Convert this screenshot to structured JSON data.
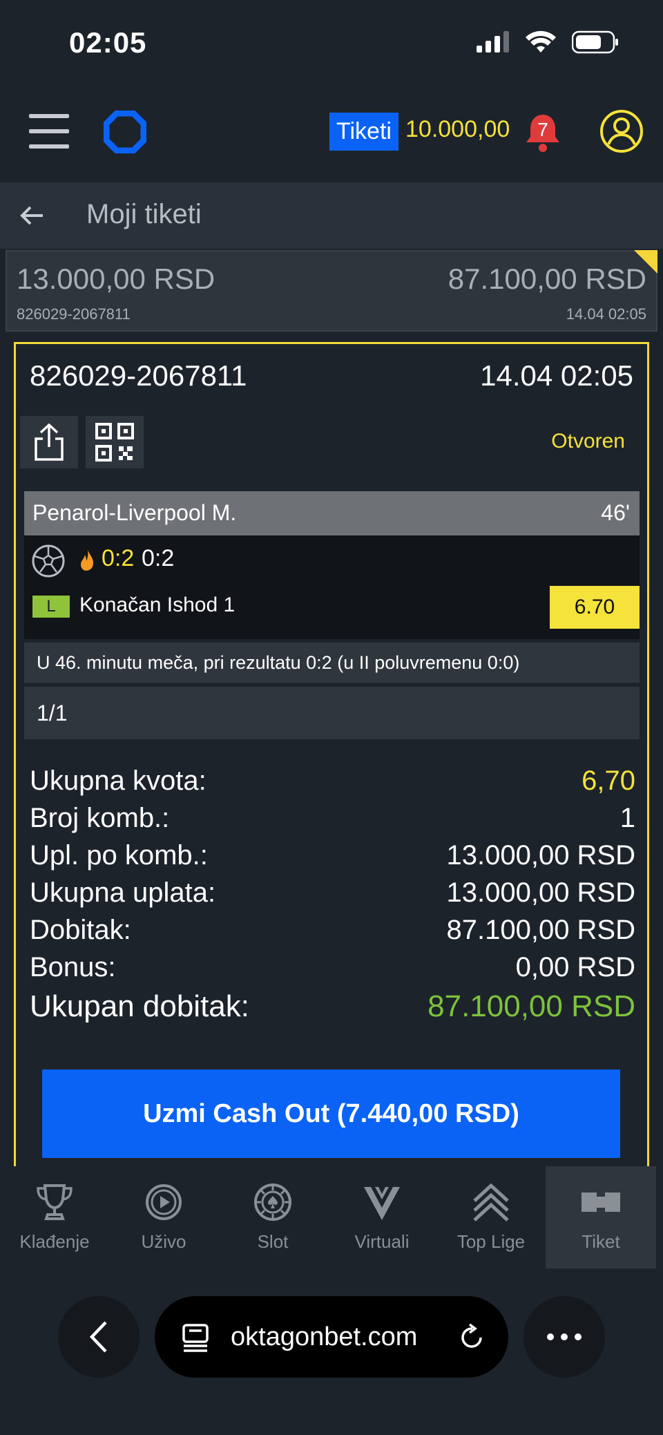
{
  "status_bar": {
    "time": "02:05"
  },
  "header": {
    "tiketi_label": "Tiketi",
    "balance": "10.000,00",
    "notifications_count": "7"
  },
  "sub_header": {
    "title": "Moji tiketi"
  },
  "summary": {
    "stake": "13.000,00 RSD",
    "payout": "87.100,00 RSD",
    "ticket_id": "826029-2067811",
    "datetime": "14.04 02:05"
  },
  "ticket": {
    "id": "826029-2067811",
    "datetime": "14.04 02:05",
    "status": "Otvoren",
    "match": {
      "name": "Penarol-Liverpool M.",
      "minute": "46'",
      "score_live": "0:2",
      "score": "0:2",
      "badge": "L",
      "pick": "Konačan Ishod 1",
      "odd": "6.70"
    },
    "note": "U 46. minutu meča, pri rezultatu 0:2 (u II poluvremenu 0:0)",
    "combination": "1/1",
    "totals": {
      "total_odds_label": "Ukupna kvota:",
      "total_odds": "6,70",
      "combos_label": "Broj komb.:",
      "combos": "1",
      "per_combo_label": "Upl. po komb.:",
      "per_combo": "13.000,00 RSD",
      "total_stake_label": "Ukupna uplata:",
      "total_stake": "13.000,00 RSD",
      "win_label": "Dobitak:",
      "win": "87.100,00 RSD",
      "bonus_label": "Bonus:",
      "bonus": "0,00 RSD",
      "total_win_label": "Ukupan dobitak:",
      "total_win": "87.100,00 RSD"
    },
    "cashout_label": "Uzmi Cash Out (7.440,00 RSD)"
  },
  "bottom_nav": [
    {
      "label": "Klađenje",
      "icon": "trophy-icon"
    },
    {
      "label": "Uživo",
      "icon": "play-icon"
    },
    {
      "label": "Slot",
      "icon": "chip-icon"
    },
    {
      "label": "Virtuali",
      "icon": "virtual-v-icon"
    },
    {
      "label": "Top Lige",
      "icon": "chevrons-up-icon"
    },
    {
      "label": "Tiket",
      "icon": "ticket-icon"
    }
  ],
  "browser": {
    "url": "oktagonbet.com"
  },
  "colors": {
    "accent_blue": "#0a63f5",
    "accent_yellow": "#f5e23a",
    "win_green": "#7dc33a",
    "background": "#1d232b"
  }
}
